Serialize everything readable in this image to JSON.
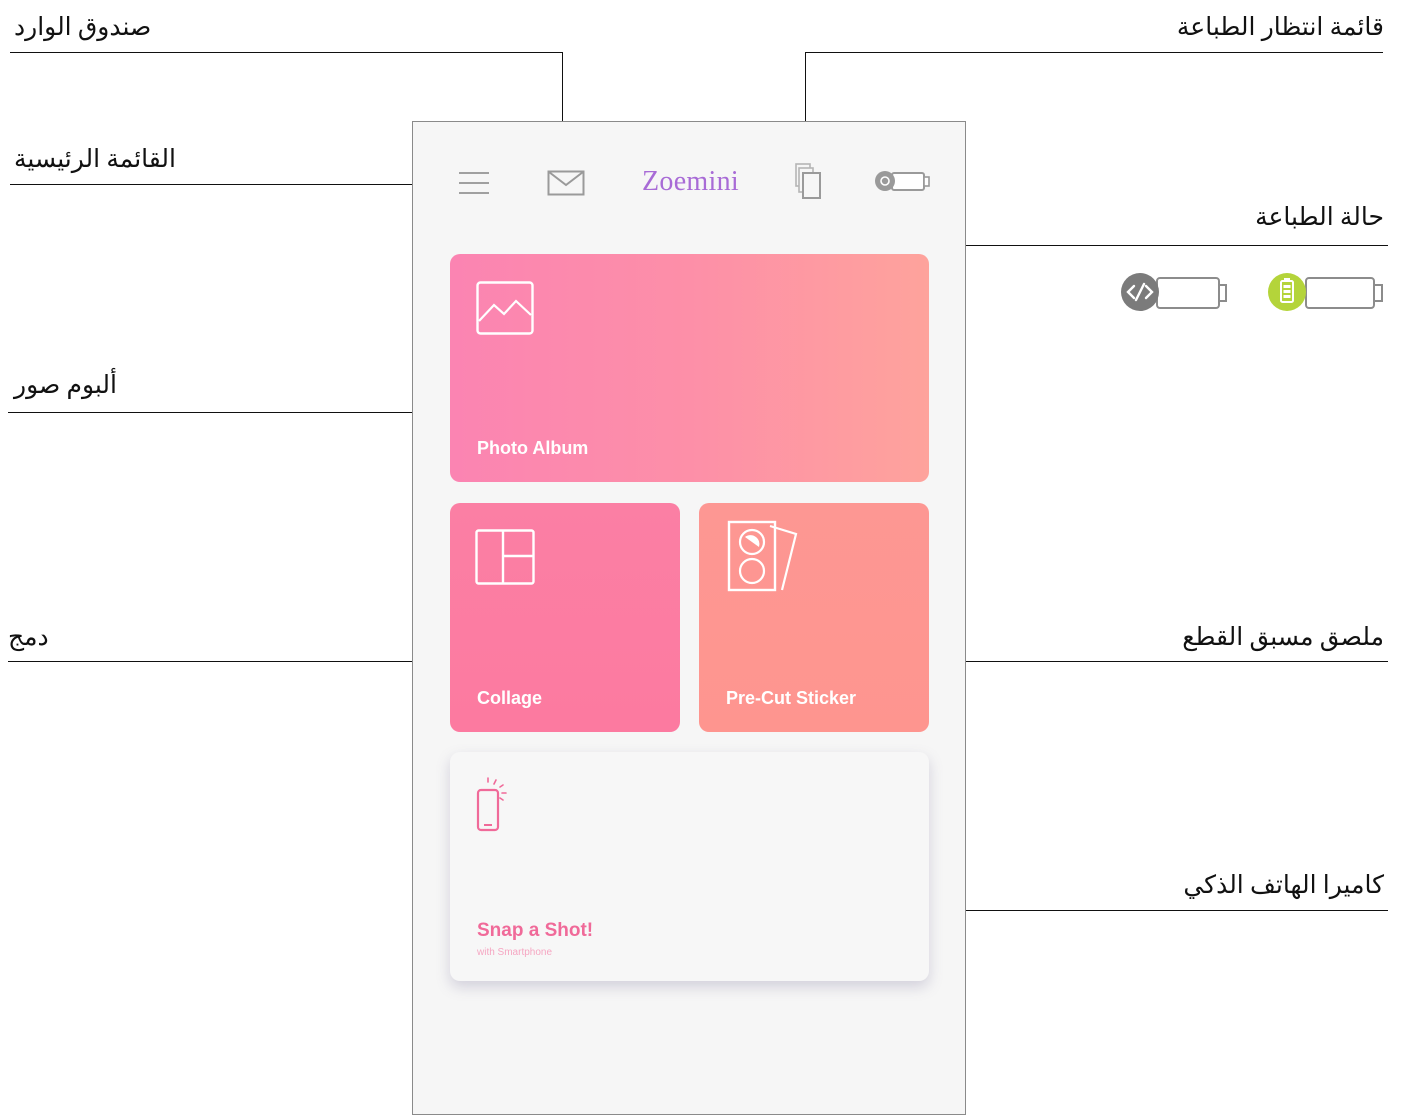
{
  "callouts": {
    "inbox": "صندوق الوارد",
    "print_queue": "قائمة انتظار الطباعة",
    "main_menu": "القائمة الرئيسية",
    "printer_status": "حالة الطباعة",
    "photo_album": "ألبوم صور",
    "collage": "دمج",
    "precut_sticker": "ملصق مسبق القطع",
    "smartphone_camera": "كاميرا الهاتف الذكي"
  },
  "app": {
    "title": "Zoemini",
    "title_color": "#a86bd6"
  },
  "topbar_icons": [
    "menu-icon",
    "mail-icon",
    "print-queue-icon",
    "printer-status-icon"
  ],
  "status_legend": {
    "disconnected_icon": "link-off-icon",
    "disconnected_color": "#7b7b7b",
    "connected_icon": "battery-icon",
    "connected_color": "#b4d43a"
  },
  "cards": {
    "photo_album": {
      "label": "Photo Album",
      "icon": "image-icon"
    },
    "collage": {
      "label": "Collage",
      "icon": "collage-grid-icon"
    },
    "precut_sticker": {
      "label": "Pre-Cut Sticker",
      "icon": "sticker-sheet-icon"
    },
    "snap": {
      "label": "Snap a Shot!",
      "sublabel": "with Smartphone",
      "icon": "smartphone-icon"
    }
  },
  "colors": {
    "photo_card": "#fd8fa8",
    "collage_card": "#fc7ca2",
    "sticker_card": "#fe968f",
    "snap_text": "#f06a99"
  }
}
